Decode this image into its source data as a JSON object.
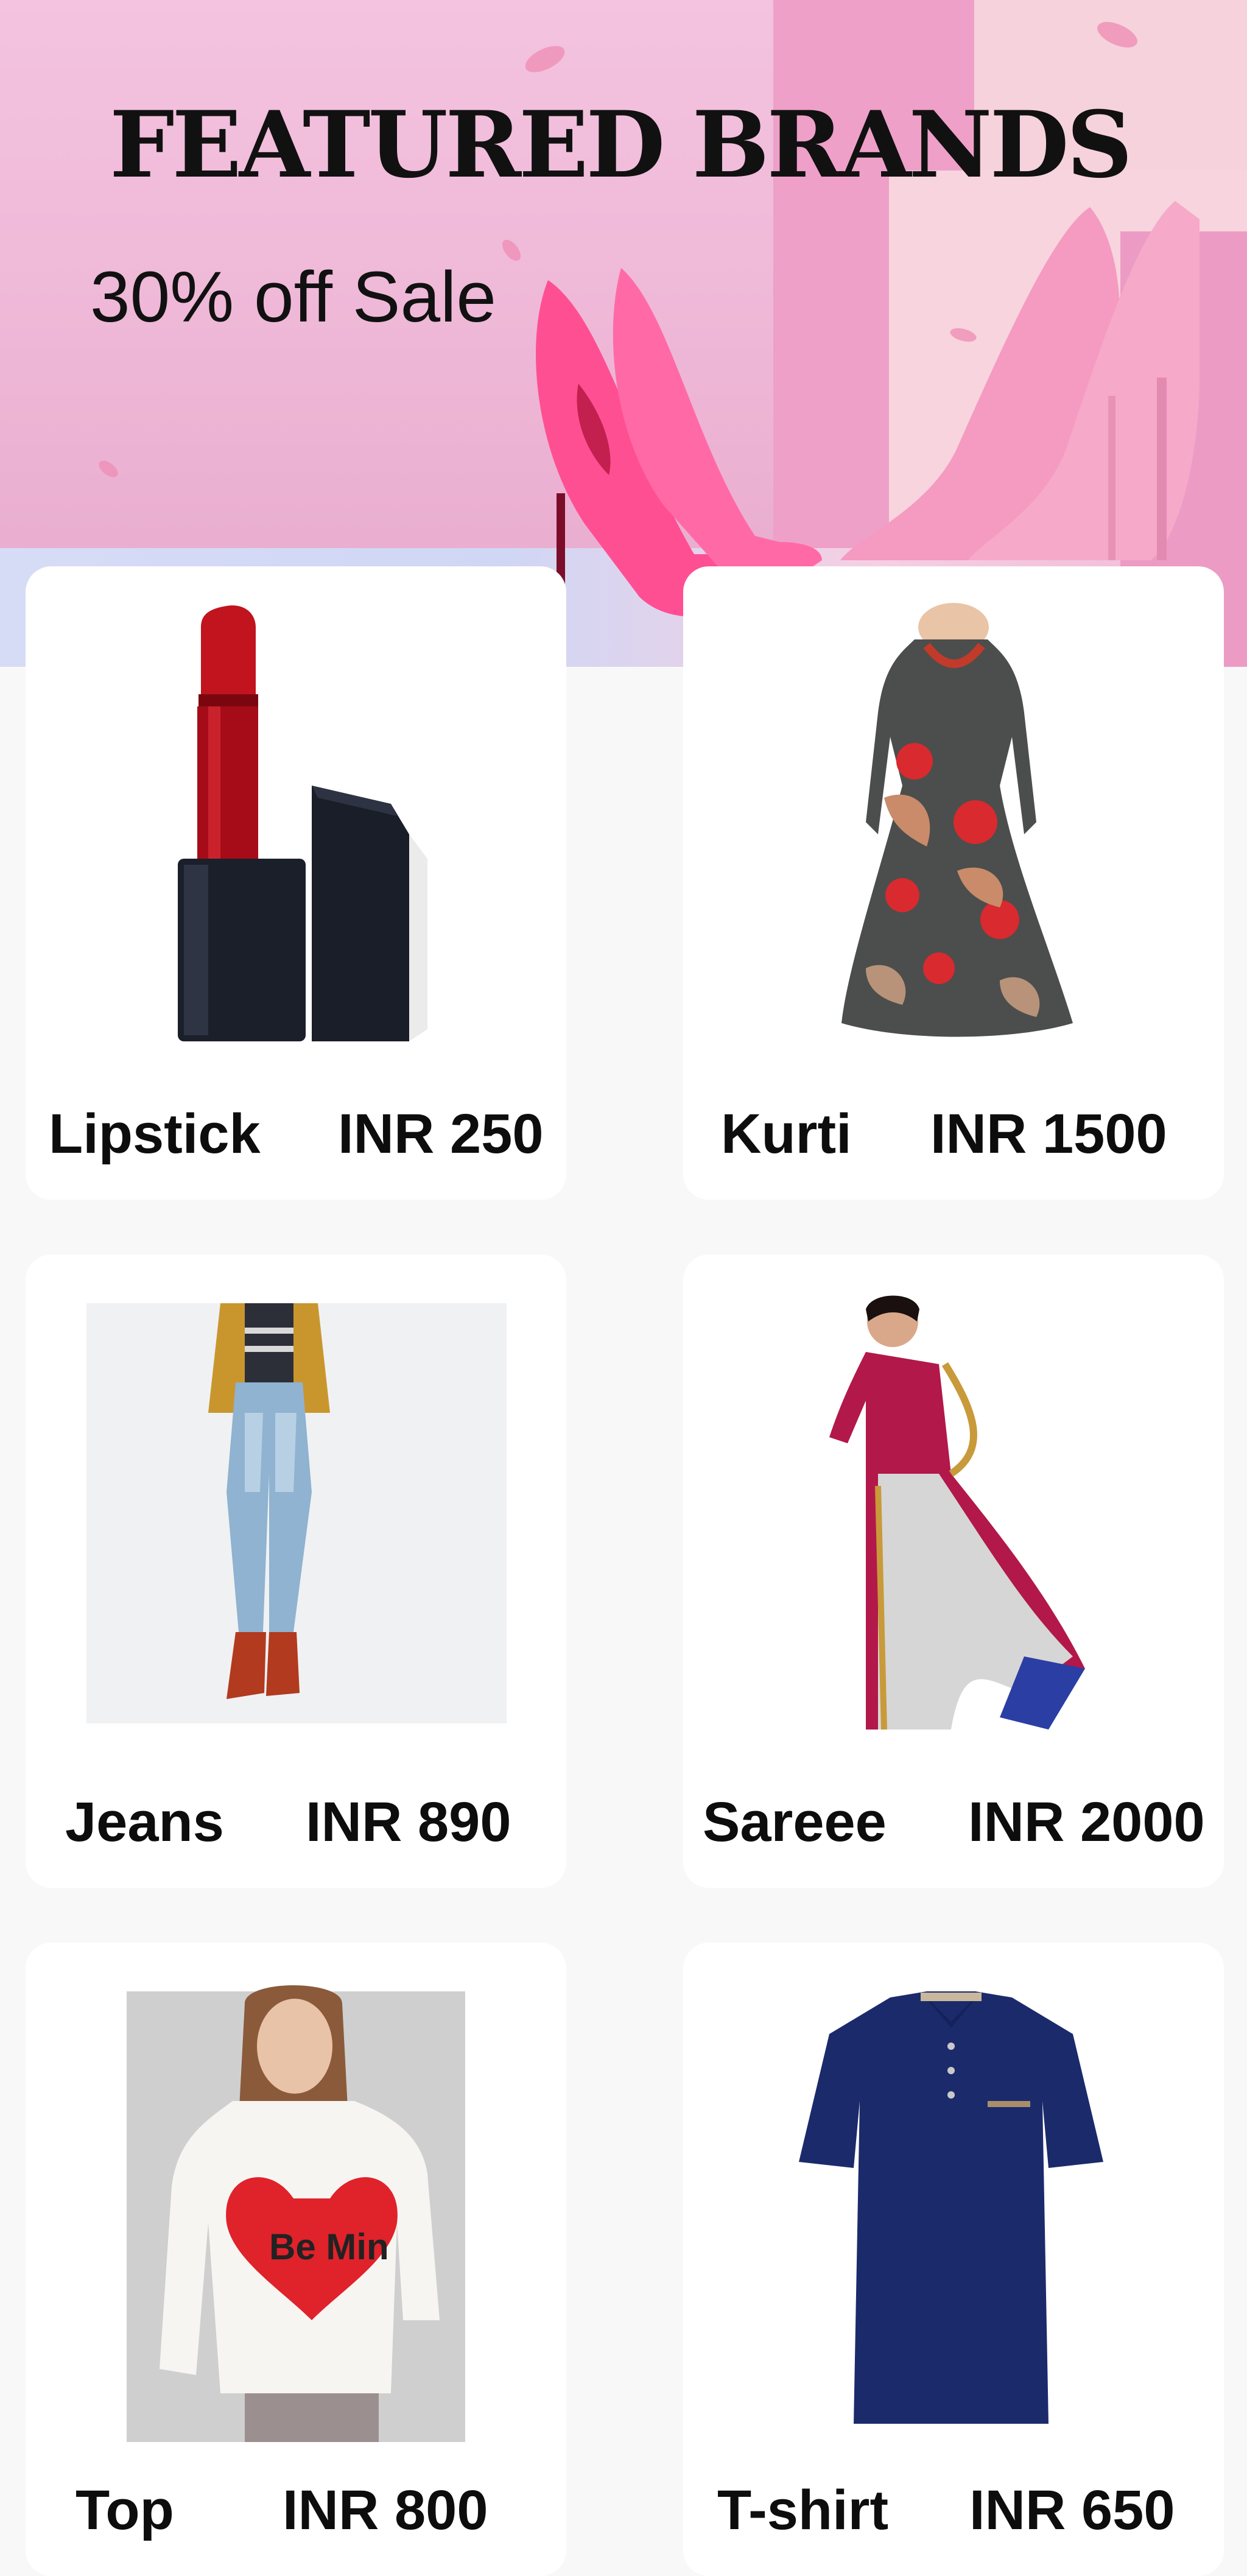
{
  "banner": {
    "title": "FEATURED BRANDS",
    "subtitle": "30% off Sale"
  },
  "products": [
    {
      "name": "Lipstick",
      "price": "INR 250",
      "icon": "lipstick-image"
    },
    {
      "name": "Kurti",
      "price": "INR 1500",
      "icon": "kurti-dress-image"
    },
    {
      "name": "Jeans",
      "price": "INR 890",
      "icon": "jeans-model-image"
    },
    {
      "name": "Sareee",
      "price": "INR 2000",
      "icon": "saree-model-image"
    },
    {
      "name": "Top",
      "price": "INR 800",
      "icon": "top-sweater-image"
    },
    {
      "name": "T-shirt",
      "price": "INR 650",
      "icon": "polo-tshirt-image"
    }
  ],
  "colors": {
    "banner_pink": "#eeb6d6",
    "card_bg": "#ffffff",
    "page_bg": "#f8f8f8"
  }
}
